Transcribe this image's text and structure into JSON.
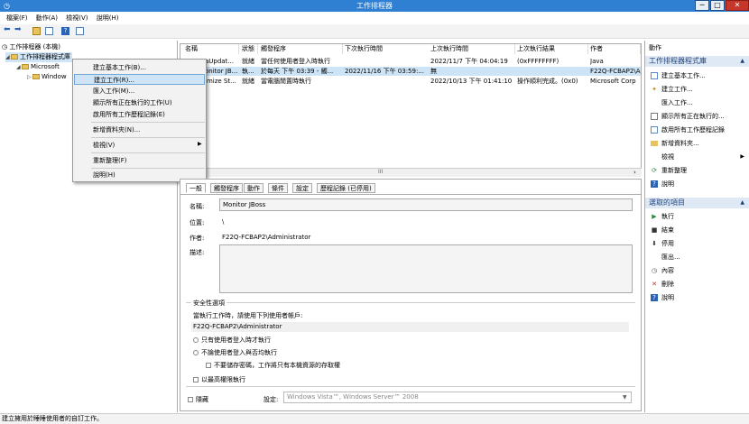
{
  "window": {
    "title": "工作排程器",
    "min": "─",
    "max": "□",
    "close": "✕"
  },
  "menu": [
    "檔案(F)",
    "動作(A)",
    "檢視(V)",
    "說明(H)"
  ],
  "tree": {
    "root": "工作排程器 (本機)",
    "library": "工作排程器程式庫",
    "microsoft": "Microsoft",
    "windows": "Window"
  },
  "context_menu": [
    "建立基本工作(B)...",
    "建立工作(R)...",
    "匯入工作(M)...",
    "顯示所有正在執行的工作(U)",
    "啟用所有工作歷程記錄(E)",
    "新增資料夾(N)...",
    "檢視(V)",
    "重新整理(F)",
    "說明(H)"
  ],
  "table": {
    "headers": [
      "名稱",
      "狀態",
      "觸發程序",
      "下次執行時間",
      "上次執行時間",
      "上次執行結果",
      "作者"
    ],
    "rows": [
      [
        "aUpdat...",
        "就緒",
        "當任何使用者登入時執行",
        "",
        "2022/11/7 下午 04:04:19",
        "(0xFFFFFFFF)",
        "Java"
      ],
      [
        "onitor JB...",
        "執...",
        "於每天 下午 03:39 - 觸...",
        "2022/11/16 下午 03:59:...",
        "無",
        "",
        "F22Q-FCBAP2\\A"
      ],
      [
        "imize St...",
        "就緒",
        "當電腦閒置時執行",
        "",
        "2022/10/13 下午 01:41:10",
        "操作順利完成。(0x0)",
        "Microsoft Corp"
      ]
    ],
    "scroll_mid": "III"
  },
  "details": {
    "tabs": [
      "一般",
      "觸發程序",
      "動作",
      "條件",
      "設定",
      "歷程記錄 (已停用)"
    ],
    "name_label": "名稱:",
    "name_value": "Monitor JBoss",
    "location_label": "位置:",
    "location_value": "\\",
    "author_label": "作者:",
    "author_value": "F22Q-FCBAP2\\Administrator",
    "desc_label": "描述:",
    "security_title": "安全性選項",
    "run_as_label": "當執行工作時，請使用下列使用者帳戶:",
    "run_as_value": "F22Q-FCBAP2\\Administrator",
    "opt_logged_on": "只有使用者登入時才執行",
    "opt_any": "不論使用者登入與否均執行",
    "opt_no_pwd": "不要儲存密碼，工作將只有本機資源的存取權",
    "opt_highest": "以最高權限執行",
    "hidden_label": "隱藏",
    "config_label": "設定:",
    "config_value": "Windows Vista™, Windows Server™ 2008"
  },
  "actions": {
    "head1": "動作",
    "section1": "工作排程器程式庫",
    "items1": [
      "建立基本工作...",
      "建立工作...",
      "匯入工作...",
      "顯示所有正在執行的...",
      "啟用所有工作歷程記錄",
      "新增資料夾...",
      "檢視",
      "重新整理",
      "說明"
    ],
    "section2": "選取的項目",
    "items2": [
      "執行",
      "結束",
      "停用",
      "匯出...",
      "內容",
      "刪除",
      "說明"
    ]
  },
  "status": "建立擁用於睡睡使用者的自訂工作。"
}
